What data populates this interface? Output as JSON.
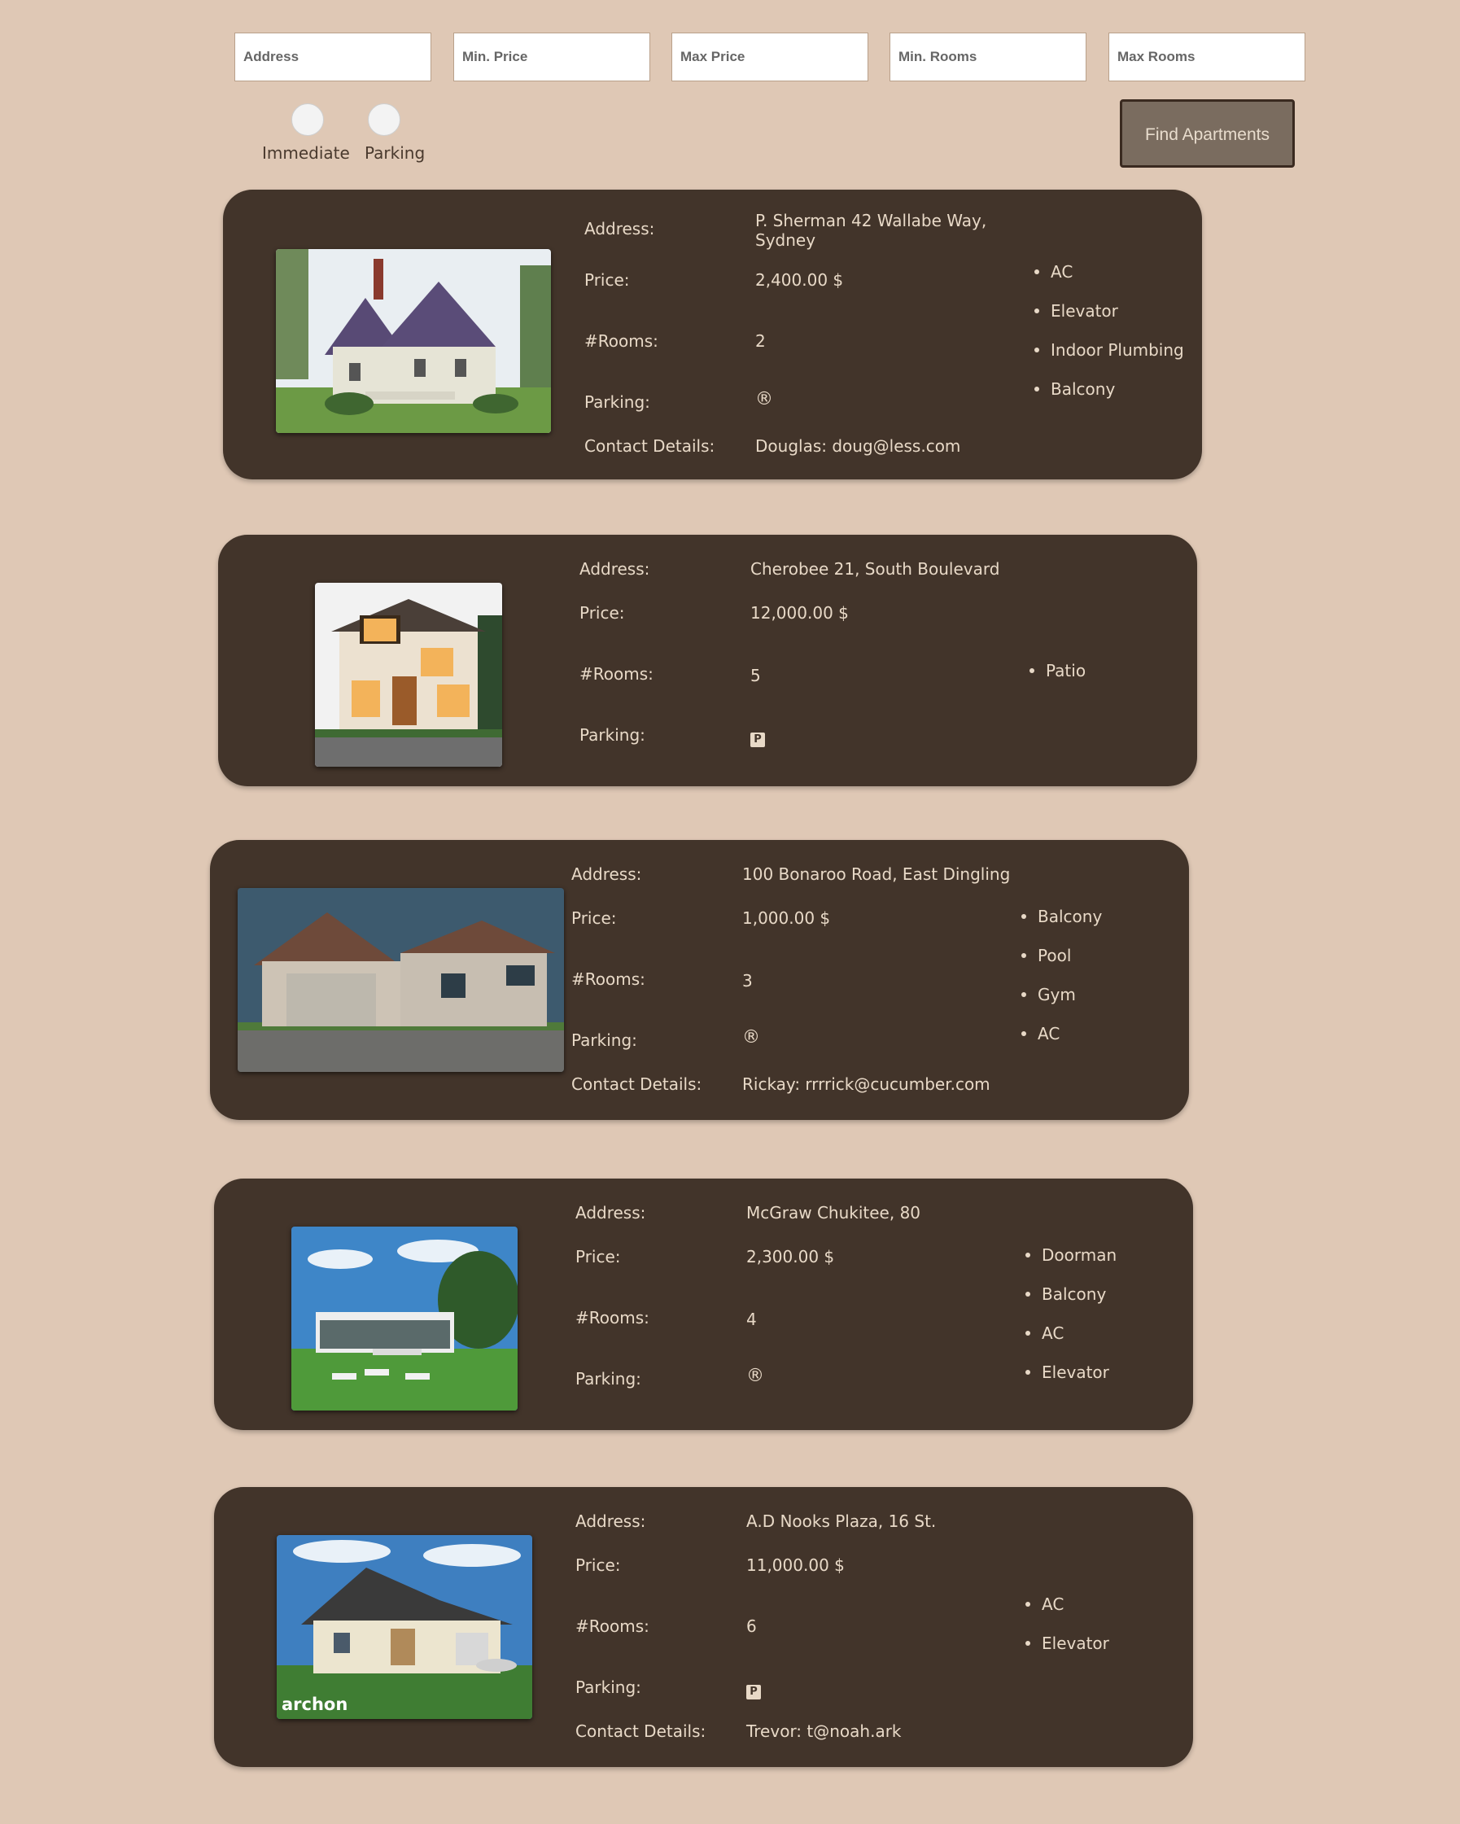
{
  "filters": {
    "address_placeholder": "Address",
    "min_price_placeholder": "Min. Price",
    "max_price_placeholder": "Max Price",
    "min_rooms_placeholder": "Min. Rooms",
    "max_rooms_placeholder": "Max Rooms",
    "immediate_label": "Immediate",
    "parking_label": "Parking",
    "find_button": "Find Apartments"
  },
  "labels": {
    "address": "Address:",
    "price": "Price:",
    "rooms": "#Rooms:",
    "parking": "Parking:",
    "contact": "Contact Details:"
  },
  "listings": [
    {
      "address": "P. Sherman 42 Wallabe Way, Sydney",
      "price": "2,400.00 $",
      "rooms": "2",
      "parking_symbol": "®",
      "contact": "Douglas: doug@less.com",
      "amenities": [
        "AC",
        "Elevator",
        "Indoor Plumbing",
        "Balcony"
      ]
    },
    {
      "address": "Cherobee 21, South Boulevard",
      "price": "12,000.00 $",
      "rooms": "5",
      "parking_symbol": "P",
      "amenities": [
        "Patio"
      ]
    },
    {
      "address": "100 Bonaroo Road, East Dingling",
      "price": "1,000.00 $",
      "rooms": "3",
      "parking_symbol": "®",
      "contact": "Rickay: rrrrick@cucumber.com",
      "amenities": [
        "Balcony",
        "Pool",
        "Gym",
        "AC"
      ]
    },
    {
      "address": "McGraw Chukitee, 80",
      "price": "2,300.00 $",
      "rooms": "4",
      "parking_symbol": "®",
      "amenities": [
        "Doorman",
        "Balcony",
        "AC",
        "Elevator"
      ]
    },
    {
      "address": "A.D Nooks Plaza, 16 St.",
      "price": "11,000.00 $",
      "rooms": "6",
      "parking_symbol": "P",
      "contact": "Trevor: t@noah.ark",
      "amenities": [
        "AC",
        "Elevator"
      ],
      "photo_watermark": "archon"
    }
  ]
}
